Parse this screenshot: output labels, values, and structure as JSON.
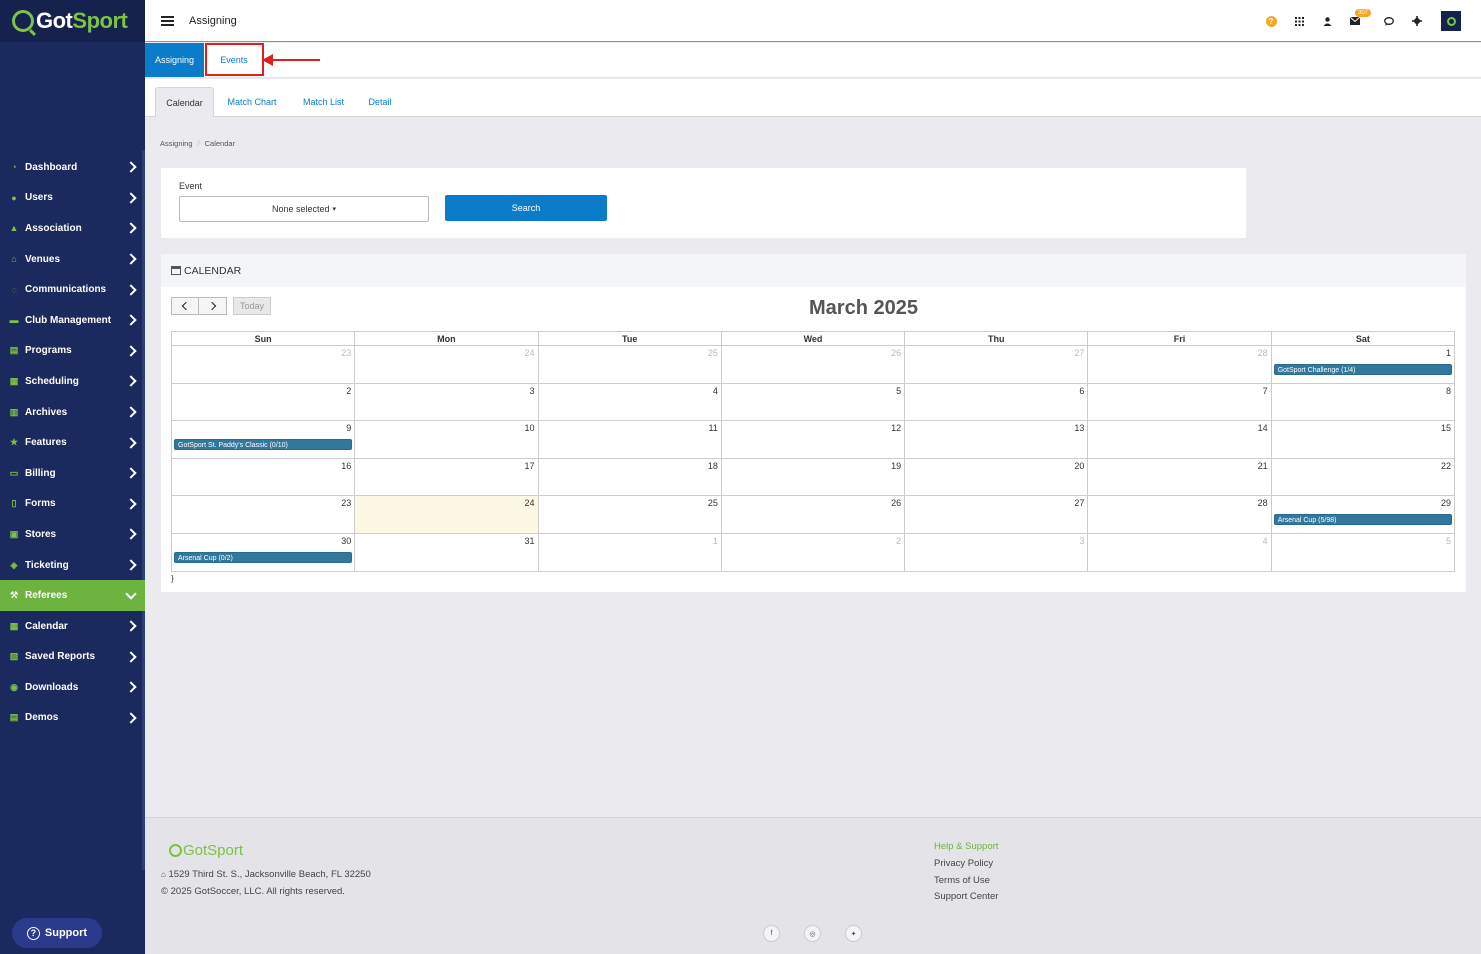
{
  "brand": {
    "part1": "Got",
    "part2": "Sport"
  },
  "header": {
    "title": "Assigning",
    "mail_badge": "307"
  },
  "sidebar": {
    "items": [
      {
        "label": "Dashboard",
        "icon": "dashboard-icon"
      },
      {
        "label": "Users",
        "icon": "users-icon"
      },
      {
        "label": "Association",
        "icon": "sitemap-icon"
      },
      {
        "label": "Venues",
        "icon": "home-icon"
      },
      {
        "label": "Communications",
        "icon": "chat-icon"
      },
      {
        "label": "Club Management",
        "icon": "club-icon"
      },
      {
        "label": "Programs",
        "icon": "programs-icon"
      },
      {
        "label": "Scheduling",
        "icon": "scheduling-icon"
      },
      {
        "label": "Archives",
        "icon": "archive-icon"
      },
      {
        "label": "Features",
        "icon": "star-icon"
      },
      {
        "label": "Billing",
        "icon": "credit-card-icon"
      },
      {
        "label": "Forms",
        "icon": "file-icon"
      },
      {
        "label": "Stores",
        "icon": "store-icon"
      },
      {
        "label": "Ticketing",
        "icon": "ticket-icon"
      },
      {
        "label": "Referees",
        "icon": "gavel-icon",
        "active": true
      },
      {
        "label": "Calendar",
        "icon": "calendar-icon"
      },
      {
        "label": "Saved Reports",
        "icon": "save-icon"
      },
      {
        "label": "Downloads",
        "icon": "download-icon"
      },
      {
        "label": "Demos",
        "icon": "demo-icon"
      }
    ],
    "support_label": "Support"
  },
  "tabs_top": [
    "Assigning",
    "Events"
  ],
  "tabs_sub": [
    "Calendar",
    "Match Chart",
    "Match List",
    "Detail"
  ],
  "breadcrumb": [
    "Assigning",
    "Calendar"
  ],
  "filter": {
    "event_label": "Event",
    "select_value": "None selected",
    "search_label": "Search"
  },
  "calendar": {
    "section_title": "CALENDAR",
    "today_label": "Today",
    "month_title": "March 2025",
    "weekdays": [
      "Sun",
      "Mon",
      "Tue",
      "Wed",
      "Thu",
      "Fri",
      "Sat"
    ],
    "weeks": [
      [
        {
          "d": "23",
          "o": true
        },
        {
          "d": "24",
          "o": true
        },
        {
          "d": "25",
          "o": true
        },
        {
          "d": "26",
          "o": true
        },
        {
          "d": "27",
          "o": true
        },
        {
          "d": "28",
          "o": true
        },
        {
          "d": "1",
          "e": "GotSport Challenge (1/4)"
        }
      ],
      [
        {
          "d": "2"
        },
        {
          "d": "3"
        },
        {
          "d": "4"
        },
        {
          "d": "5"
        },
        {
          "d": "6"
        },
        {
          "d": "7"
        },
        {
          "d": "8"
        }
      ],
      [
        {
          "d": "9",
          "e": "GotSport St. Paddy's Classic (0/10)"
        },
        {
          "d": "10"
        },
        {
          "d": "11"
        },
        {
          "d": "12"
        },
        {
          "d": "13"
        },
        {
          "d": "14"
        },
        {
          "d": "15"
        }
      ],
      [
        {
          "d": "16"
        },
        {
          "d": "17"
        },
        {
          "d": "18"
        },
        {
          "d": "19"
        },
        {
          "d": "20"
        },
        {
          "d": "21"
        },
        {
          "d": "22"
        }
      ],
      [
        {
          "d": "23"
        },
        {
          "d": "24",
          "t": true
        },
        {
          "d": "25"
        },
        {
          "d": "26"
        },
        {
          "d": "27"
        },
        {
          "d": "28"
        },
        {
          "d": "29",
          "e": "Arsenal Cup (5/98)"
        }
      ],
      [
        {
          "d": "30",
          "e": "Arsenal Cup (0/2)"
        },
        {
          "d": "31"
        },
        {
          "d": "1",
          "o": true
        },
        {
          "d": "2",
          "o": true
        },
        {
          "d": "3",
          "o": true
        },
        {
          "d": "4",
          "o": true
        },
        {
          "d": "5",
          "o": true
        }
      ]
    ],
    "stray_text": "}"
  },
  "footer": {
    "logo_text": "GotSport",
    "address": "1529 Third St. S., Jacksonville Beach, FL 32250",
    "copyright": "© 2025 GotSoccer, LLC. All rights reserved.",
    "links": [
      "Help & Support",
      "Privacy Policy",
      "Terms of Use",
      "Support Center"
    ],
    "social": [
      "facebook-icon",
      "instagram-icon",
      "twitter-icon"
    ]
  },
  "colors": {
    "sidebar": "#1a2a5e",
    "accent_green": "#6cb33f",
    "primary_blue": "#0a7cc9",
    "event_bar": "#31779e",
    "annotation_red": "#e02020"
  }
}
